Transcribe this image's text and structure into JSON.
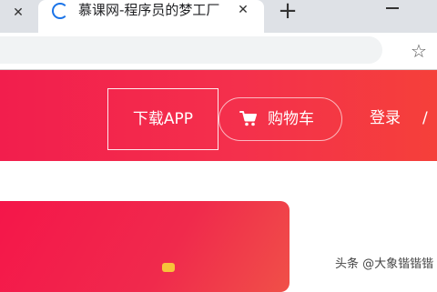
{
  "browser": {
    "active_tab_title": "慕课网-程序员的梦工厂",
    "close_glyph": "✕",
    "new_tab_glyph": "+",
    "bookmark_glyph": "☆"
  },
  "header": {
    "download_app": "下载APP",
    "cart": "购物车",
    "login": "登录",
    "separator": "/"
  },
  "watermark": "头条 @大象锴锴锴",
  "colors": {
    "brand_red": "#f21e4d",
    "tab_strip": "#dee1e6",
    "spinner": "#1a73e8"
  },
  "icons": [
    "close-icon",
    "loading-spinner-icon",
    "plus-icon",
    "minimize-icon",
    "star-icon",
    "cart-icon"
  ]
}
